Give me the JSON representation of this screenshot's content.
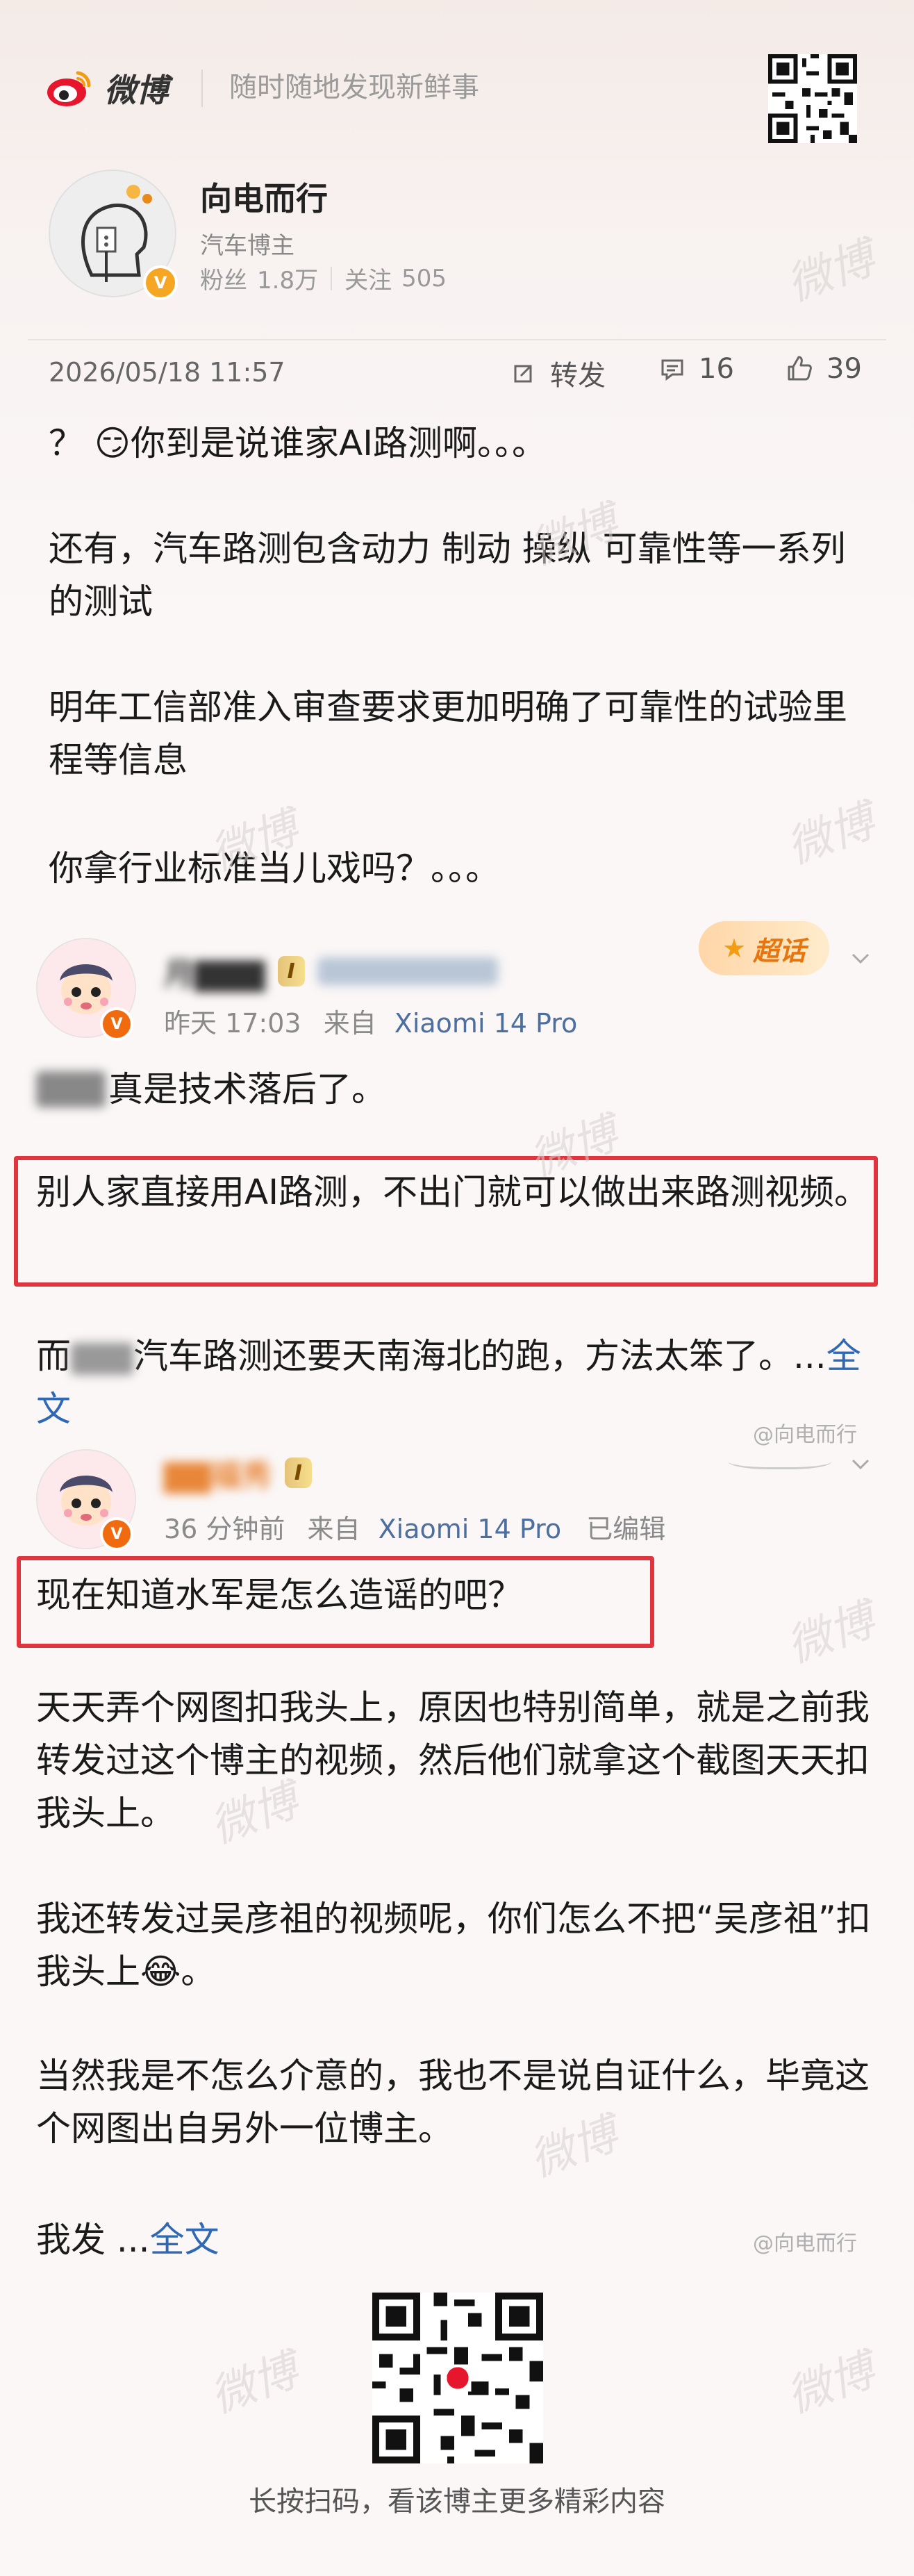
{
  "header": {
    "brand": "微博",
    "slogan": "随时随地发现新鲜事"
  },
  "profile": {
    "name": "向电而行",
    "description": "汽车博主",
    "followers_label": "粉丝",
    "followers": "1.8万",
    "following_label": "关注",
    "following": "505"
  },
  "post": {
    "time": "2026/05/18 11:57",
    "repost_label": "转发",
    "comment_count": "16",
    "like_count": "39",
    "paragraphs": [
      "？ 😏你到是说谁家AI路测啊。。。",
      "还有，汽车路测包含动力 制动 操纵 可靠性等一系列的测试",
      "明年工信部准入审查要求更加明确了可靠性的试验里程等信息",
      "你拿行业标准当儿戏吗？。。。"
    ]
  },
  "comment1": {
    "name": "月▇▇▇",
    "level": "I",
    "meta_time": "昨天 17:03",
    "meta_from": "来自",
    "meta_device": "Xiaomi 14 Pro",
    "supertopic": "超话",
    "line1": "真是技术落后了。",
    "highlight": "别人家直接用AI路测，不出门就可以做出来路测视频。",
    "line3_prefix": "而",
    "line3": "汽车路测还要天南海北的跑，方法太笨了。...",
    "full_text": "全文",
    "watermark": "@向电而行"
  },
  "comment2": {
    "name": "▇▇福秀",
    "level": "I",
    "meta_time": "36 分钟前",
    "meta_from": "来自",
    "meta_device": "Xiaomi 14 Pro",
    "edited": "已编辑",
    "highlight": "现在知道水军是怎么造谣的吧？",
    "p1": "天天弄个网图扣我头上，原因也特别简单，就是之前我转发过这个博主的视频，然后他们就拿这个截图天天扣我头上。",
    "p2": "我还转发过吴彦祖的视频呢，你们怎么不把“吴彦祖”扣我头上😂。",
    "p3": "当然我是不怎么介意的，我也不是说自证什么，毕竟这个网图出自另外一位博主。",
    "p4": "我发 ...",
    "full_text": "全文",
    "watermark": "@向电而行"
  },
  "footer": {
    "text": "长按扫码，看该博主更多精彩内容"
  },
  "watermark_text": "微博"
}
